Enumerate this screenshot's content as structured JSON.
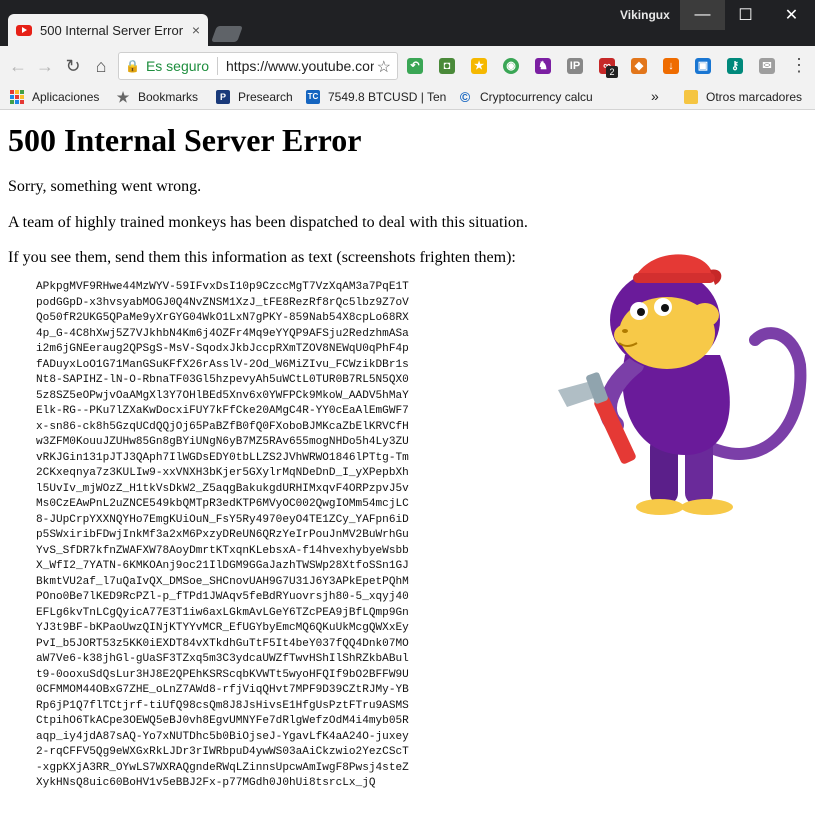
{
  "window": {
    "tab_title": "500 Internal Server Error",
    "tab_close": "×",
    "profile_name": "Vikingux",
    "minimize": "—",
    "maximize": "☐",
    "close": "✕"
  },
  "toolbar": {
    "back": "←",
    "forward": "→",
    "reload": "↻",
    "home": "⌂",
    "lock_icon": "🔒",
    "secure_label": "Es seguro",
    "url": "https://www.youtube.com",
    "star": "☆",
    "menu": "⋮",
    "extension_badge": "2"
  },
  "bookmarks": {
    "apps": "Aplicaciones",
    "bookmarks": "Bookmarks",
    "presearch": "Presearch",
    "btc": "7549.8 BTCUSD | Ten",
    "crypto": "Cryptocurrency calcu",
    "overflow": "»",
    "others": "Otros marcadores"
  },
  "page": {
    "title": "500 Internal Server Error",
    "line1": "Sorry, something went wrong.",
    "line2": "A team of highly trained monkeys has been dispatched to deal with this situation.",
    "line3": "If you see them, send them this information as text (screenshots frighten them):",
    "error_code": "APkpgMVF9RHwe44MzWYV-59IFvxDsI10p9CzccMgT7VzXqAM3a7PqE1T\npodGGpD-x3hvsyabMOGJ0Q4NvZNSM1XzJ_tFE8RezRf8rQc5lbz9Z7oV\nQo50fR2UKG5QPaMe9yXrGYG04WkO1LxN7gPKY-859Nab54X8cpLo68RX\n4p_G-4C8hXwj5Z7VJkhbN4Km6j4OZFr4Mq9eYYQP9AFSju2RedzhmASa\ni2m6jGNEeraug2QPSgS-MsV-SqodxJkbJccpRXmTZOV8NEWqU0qPhF4p\nfADuyxLoO1G71ManGSuKFfX26rAsslV-2Od_W6MiZIvu_FCWzikDBr1s\nNt8-SAPIHZ-lN-O-RbnaTF03Gl5hzpevyAh5uWCtL0TUR0B7RL5N5QX0\n5z8SZ5eOPwjvOaAMgXl3Y7OHlBEd5Xnv6x0YWFPCk9MkoW_AADV5hMaY\nElk-RG--PKu7lZXaKwDocxiFUY7kFfCke20AMgC4R-YY0cEaAlEmGWF7\nx-sn86-ck8h5GzqUCdQQjOj65PaBZfB0fQ0FXoboBJMKcaZbElKRVCfH\nw3ZFM0KouuJZUHw85Gn8gBYiUNgN6yB7MZ5RAv655mogNHDo5h4Ly3ZU\nvRKJGin131pJTJ3QAph7IlWGDsEDY0tbLLZS2JVhWRWO1846lPTtg-Tm\n2CKxeqnya7z3KULIw9-xxVNXH3bKjer5GXylrMqNDeDnD_I_yXPepbXh\nl5UvIv_mjWOzZ_H1tkVsDkW2_Z5aqgBakukgdURHIMxqvF4ORPzpvJ5v\nMs0CzEAwPnL2uZNCE549kbQMTpR3edKTP6MVyOC002QwgIOMm54mcjLC\n8-JUpCrpYXXNQYHo7EmgKUiOuN_FsY5Ry4970eyO4TE1ZCy_YAFpn6iD\np5SWxiribFDwjInkMf3a2xM6PxzyDReUN6QRzYeIrPouJnMV2BuWrhGu\nYvS_SfDR7kfnZWAFXW78AoyDmrtKTxqnKLebsxA-f14hvexhybyeWsbb\nX_WfI2_7YATN-6KMKOAnj9oc21IlDGM9GGaJazhTWSWp28XtfoSSn1GJ\nBkmtVU2af_l7uQaIvQX_DMSoe_SHCnovUAH9G7U31J6Y3APkEpetPQhM\nPOno0Be7lKED9RcPZl-p_fTPd1JWAqv5feBdRYuovrsjh80-5_xqyj40\nEFLg6kvTnLCgQyicA77E3T1iw6axLGkmAvLGeY6TZcPEA9jBfLQmp9Gn\nYJ3t9BF-bKPaoUwzQINjKTYYvMCR_EfUGYbyEmcMQ6QKuUkMcgQWXxEy\nPvI_b5JORT53z5KK0iEXDT84vXTkdhGuTtF5It4beY037fQQ4Dnk07MO\naW7Ve6-k38jhGl-gUaSF3TZxq5m3C3ydcaUWZfTwvHShIlShRZkbABul\nt9-0ooxuSdQsLur3HJ8E2QPEhKSRScqbKVWTt5wyoHFQIf9bO2BFFW9U\n0CFMMOM44OBxG7ZHE_oLnZ7AWd8-rfjViqQHvt7MPF9D39CZtRJMy-YB\nRp6jP1Q7flTCtjrf-tiUfQ98csQm8J8JsHivsE1HfgUsPztFTru9ASMS\nCtpihO6TkACpe3OEWQ5eBJ0vh8EgvUMNYFe7dRlgWefzOdM4i4myb05R\naqp_iy4jdA87sAQ-Yo7xNUTDhc5b0BiOjseJ-YgavLfK4aA24O-juxey\n2-rqCFFV5Qg9eWXGxRkLJDr3rIWRbpuD4ywWS03aAiCkzwio2YezCScT\n-xgpKXjA3RR_OYwLS7WXRAQgndeRWqLZinnsUpcwAmIwgF8Pwsj4steZ\nXykHNsQ8uic60BoHV1v5eBBJ2Fx-p77MGdh0J0hUi8tsrcLx_jQ"
  },
  "colors": {
    "titlebar": "#202124",
    "chrome": "#f2f2f2",
    "secure_green": "#1e8e3e",
    "monkey_purple": "#6a1b9a",
    "monkey_face": "#f7c948",
    "hat_red": "#e53935"
  }
}
